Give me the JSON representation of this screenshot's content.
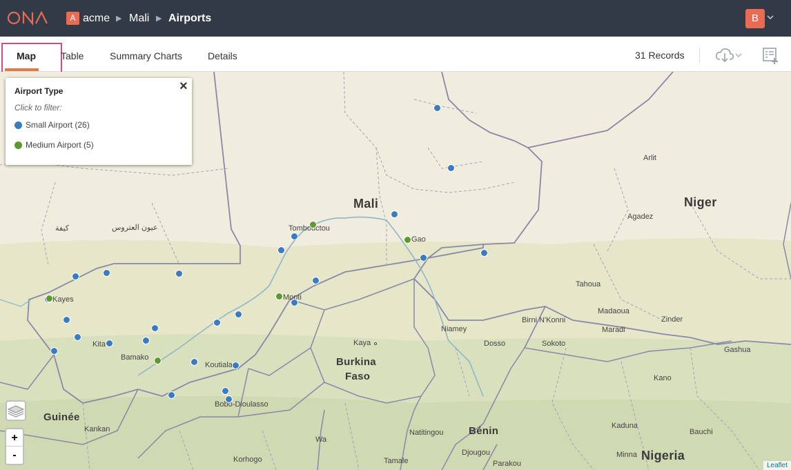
{
  "header": {
    "logo_text": "ONA",
    "org_badge": "A",
    "org": "acme",
    "separator": "▶",
    "project": "Mali",
    "form": "Airports",
    "user_initial": "B",
    "brand_color": "#e86b53",
    "bar_color": "#323a48"
  },
  "tabs": [
    {
      "label": "Map",
      "active": true
    },
    {
      "label": "Table",
      "active": false
    },
    {
      "label": "Summary Charts",
      "active": false
    },
    {
      "label": "Details",
      "active": false
    }
  ],
  "toolbar": {
    "records": "31 Records",
    "download_icon": "cloud-download-icon",
    "add_icon": "add-record-icon"
  },
  "legend": {
    "title": "Airport Type",
    "hint": "Click to filter:",
    "items": [
      {
        "label": "Small Airport (26)",
        "color": "#3a7cc0"
      },
      {
        "label": "Medium Airport (5)",
        "color": "#5c9a2b"
      }
    ],
    "close": "×"
  },
  "map": {
    "countries": [
      "Mali",
      "Niger",
      "Burkina",
      "Faso",
      "Guinée",
      "Bénin",
      "Nigeria"
    ],
    "places": [
      "Tombouctou",
      "Gao",
      "Kayes",
      "Kita",
      "Bamako",
      "Mopti",
      "Koutiala",
      "Bobo-Dioulasso",
      "Kaya",
      "Niamey",
      "Dosso",
      "Birni N'Konni",
      "Sokoto",
      "Tahoua",
      "Madaoua",
      "Maradi",
      "Zinder",
      "Agadez",
      "Arlit",
      "Gashua",
      "Kano",
      "Kaduna",
      "Bauchi",
      "Minna",
      "Djougou",
      "Parakou",
      "Tamale",
      "Wa",
      "Natitingou",
      "Kankan",
      "Korhogo",
      "كيفة",
      "عيون العتروس"
    ],
    "zoom_in": "+",
    "zoom_out": "-",
    "attribution": "Leaflet"
  }
}
